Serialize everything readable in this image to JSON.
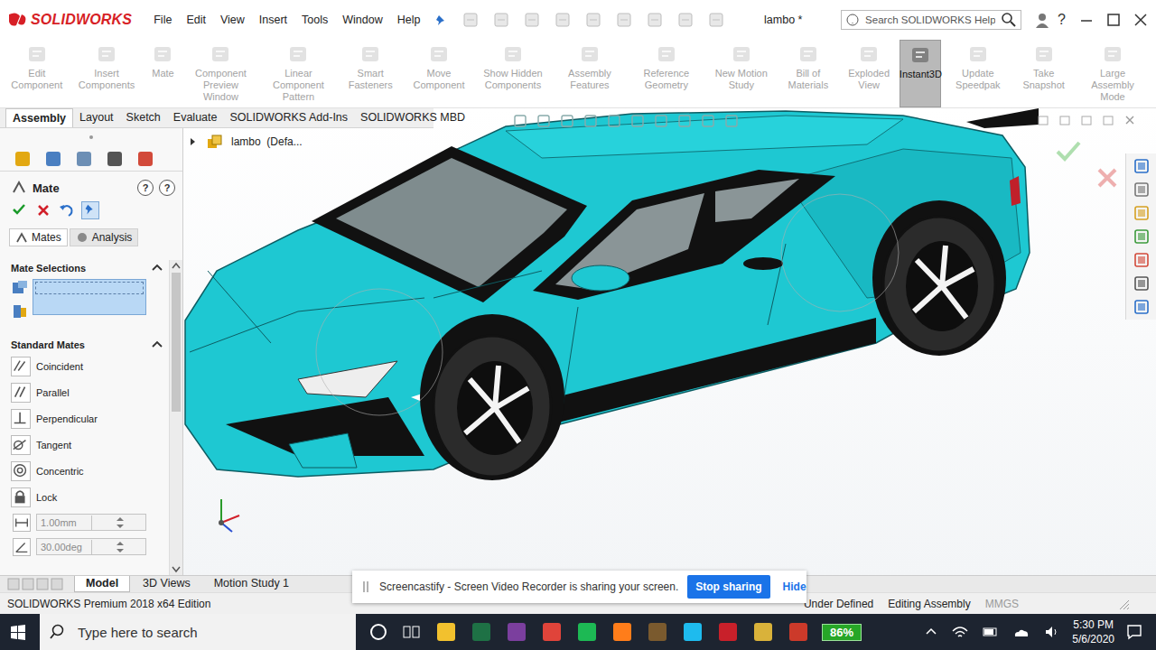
{
  "app": {
    "logo": "SOLIDWORKS",
    "title": "lambo *",
    "help": "?"
  },
  "menu": [
    "File",
    "Edit",
    "View",
    "Insert",
    "Tools",
    "Window",
    "Help"
  ],
  "search": {
    "placeholder": "Search SOLIDWORKS Help"
  },
  "ribbon": [
    {
      "label": "Edit Component",
      "disabled": true,
      "selected": false
    },
    {
      "label": "Insert Components",
      "disabled": true,
      "selected": false
    },
    {
      "label": "Mate",
      "disabled": true,
      "selected": false
    },
    {
      "label": "Component Preview Window",
      "disabled": true,
      "selected": false
    },
    {
      "label": "Linear Component Pattern",
      "disabled": true,
      "selected": false
    },
    {
      "label": "Smart Fasteners",
      "disabled": true,
      "selected": false
    },
    {
      "label": "Move Component",
      "disabled": true,
      "selected": false
    },
    {
      "label": "Show Hidden Components",
      "disabled": true,
      "selected": false
    },
    {
      "label": "Assembly Features",
      "disabled": true,
      "selected": false
    },
    {
      "label": "Reference Geometry",
      "disabled": true,
      "selected": false
    },
    {
      "label": "New Motion Study",
      "disabled": true,
      "selected": false
    },
    {
      "label": "Bill of Materials",
      "disabled": true,
      "selected": false
    },
    {
      "label": "Exploded View",
      "disabled": true,
      "selected": false
    },
    {
      "label": "Instant3D",
      "disabled": false,
      "selected": true
    },
    {
      "label": "Update Speedpak",
      "disabled": true,
      "selected": false
    },
    {
      "label": "Take Snapshot",
      "disabled": true,
      "selected": false
    },
    {
      "label": "Large Assembly Mode",
      "disabled": true,
      "selected": false
    }
  ],
  "tabs": [
    {
      "label": "Assembly",
      "selected": true
    },
    {
      "label": "Layout",
      "selected": false
    },
    {
      "label": "Sketch",
      "selected": false
    },
    {
      "label": "Evaluate",
      "selected": false
    },
    {
      "label": "SOLIDWORKS Add-Ins",
      "selected": false
    },
    {
      "label": "SOLIDWORKS MBD",
      "selected": false
    }
  ],
  "panel": {
    "title": "Mate",
    "help_icons": [
      "?",
      "?"
    ],
    "pinned": true,
    "tabs": [
      {
        "label": "Mates",
        "selected": true
      },
      {
        "label": "Analysis",
        "selected": false
      }
    ],
    "mate_selections": {
      "title": "Mate Selections",
      "expanded": true
    },
    "standard_mates": {
      "title": "Standard Mates",
      "expanded": true,
      "items": [
        {
          "label": "Coincident",
          "selected": false
        },
        {
          "label": "Parallel",
          "selected": false
        },
        {
          "label": "Perpendicular",
          "selected": false
        },
        {
          "label": "Tangent",
          "selected": false
        },
        {
          "label": "Concentric",
          "selected": false
        },
        {
          "label": "Lock",
          "selected": false
        }
      ],
      "distance": {
        "value": "1.00mm",
        "disabled": true
      },
      "angle": {
        "value": "30.00deg",
        "disabled": true
      }
    },
    "scroll": {
      "level": 0.48
    }
  },
  "tree": {
    "label": "lambo  (Defa...",
    "expanded": false
  },
  "bottom_tabs": [
    {
      "label": "Model",
      "selected": true
    },
    {
      "label": "3D Views",
      "selected": false
    },
    {
      "label": "Motion Study 1",
      "selected": false
    }
  ],
  "notification": {
    "text": "Screencastify - Screen Video Recorder is sharing your screen.",
    "primary": "Stop sharing",
    "secondary": "Hide"
  },
  "status_bar": {
    "edition": "SOLIDWORKS Premium 2018 x64 Edition",
    "items": [
      {
        "label": "Under Defined",
        "disabled": false
      },
      {
        "label": "Editing Assembly",
        "disabled": false
      },
      {
        "label": "MMGS",
        "disabled": true
      }
    ]
  },
  "taskbar": {
    "search_placeholder": "Type here to search",
    "battery": "86%",
    "time": "5:30 PM",
    "date": "5/6/2020"
  }
}
